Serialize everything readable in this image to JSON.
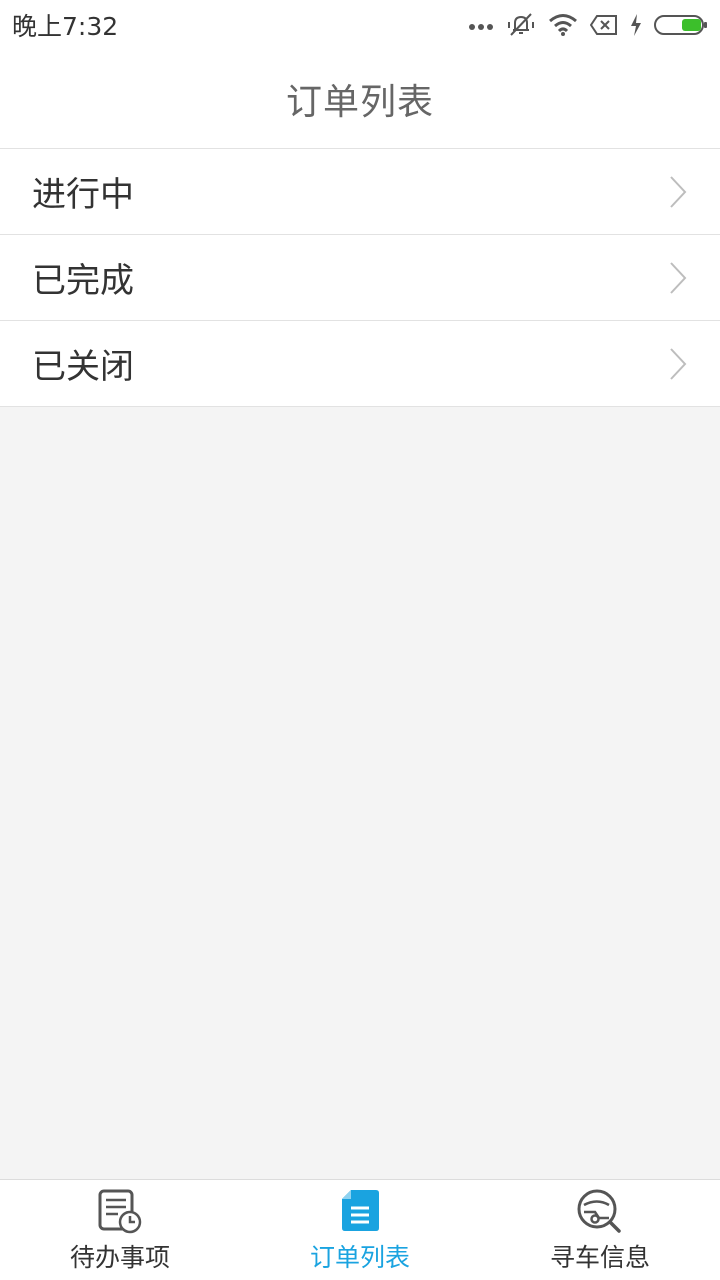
{
  "status_bar": {
    "time": "晚上7:32",
    "icons": [
      "more-dots-icon",
      "mute-vibrate-icon",
      "wifi-icon",
      "no-sim-icon",
      "charging-icon",
      "battery-icon"
    ],
    "battery_color": "#3cbf2b"
  },
  "header": {
    "title": "订单列表"
  },
  "orders": {
    "items": [
      {
        "label": "进行中"
      },
      {
        "label": "已完成"
      },
      {
        "label": "已关闭"
      }
    ]
  },
  "tab_bar": {
    "active_color": "#1aa3e0",
    "tabs": [
      {
        "label": "待办事项",
        "icon": "todo-clock-icon",
        "active": false
      },
      {
        "label": "订单列表",
        "icon": "document-icon",
        "active": true
      },
      {
        "label": "寻车信息",
        "icon": "car-search-icon",
        "active": false
      }
    ]
  }
}
